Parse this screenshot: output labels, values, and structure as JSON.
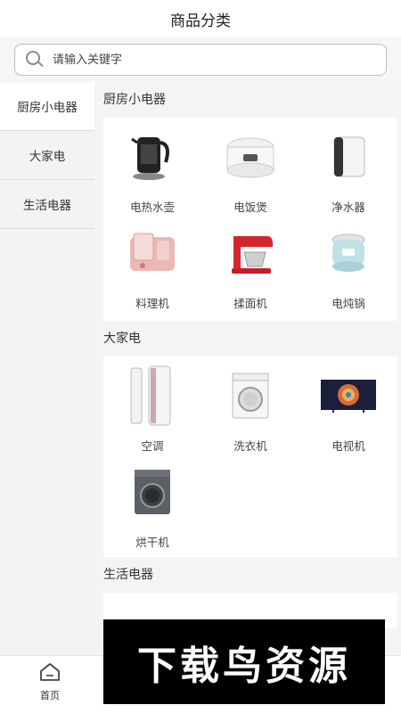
{
  "header": {
    "title": "商品分类"
  },
  "search": {
    "placeholder": "请输入关键字",
    "icon": "search-icon"
  },
  "sidebar": {
    "items": [
      {
        "label": "厨房小电器",
        "active": true
      },
      {
        "label": "大家电",
        "active": false
      },
      {
        "label": "生活电器",
        "active": false
      }
    ]
  },
  "sections": [
    {
      "title": "厨房小电器",
      "items": [
        {
          "label": "电热水壶",
          "icon": "kettle-image"
        },
        {
          "label": "电饭煲",
          "icon": "rice-cooker-image"
        },
        {
          "label": "净水器",
          "icon": "water-purifier-image"
        },
        {
          "label": "料理机",
          "icon": "blender-image"
        },
        {
          "label": "揉面机",
          "icon": "stand-mixer-image"
        },
        {
          "label": "电炖锅",
          "icon": "slow-cooker-image"
        }
      ]
    },
    {
      "title": "大家电",
      "items": [
        {
          "label": "空调",
          "icon": "air-conditioner-image"
        },
        {
          "label": "洗衣机",
          "icon": "washing-machine-image"
        },
        {
          "label": "电视机",
          "icon": "tv-image"
        },
        {
          "label": "烘干机",
          "icon": "dryer-image"
        }
      ]
    },
    {
      "title": "生活电器"
    }
  ],
  "tabbar": {
    "home_label": "首页",
    "home_icon": "home-icon"
  },
  "watermark": {
    "text": "下载鸟资源"
  }
}
